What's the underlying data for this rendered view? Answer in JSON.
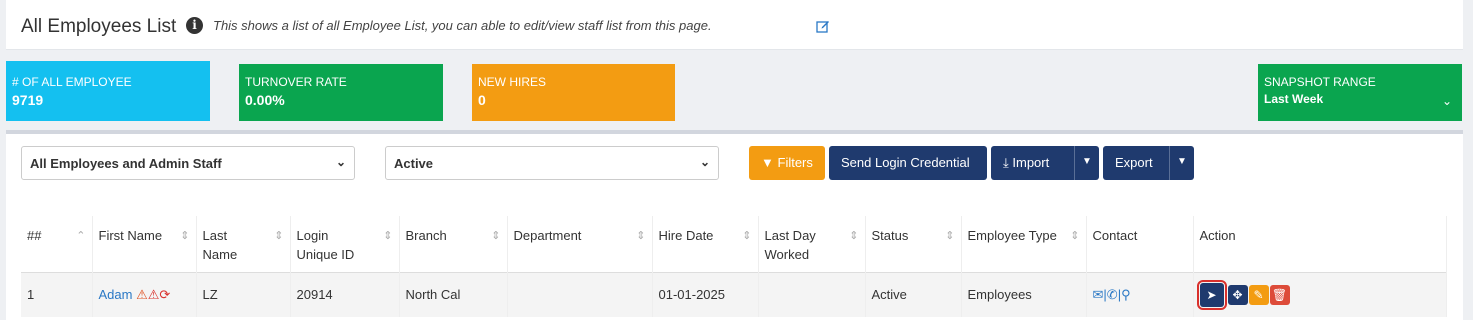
{
  "header": {
    "title": "All Employees List",
    "description": "This shows a list of all Employee List, you can able to edit/view staff list from this page.",
    "info_icon": "info-icon",
    "edit_icon": "edit-icon"
  },
  "stats": {
    "all_employee": {
      "label": "# OF ALL EMPLOYEE",
      "value": "9719",
      "color": "#14c0f0"
    },
    "turnover": {
      "label": "TURNOVER RATE",
      "value": "0.00%",
      "color": "#0aa54f"
    },
    "new_hires": {
      "label": "NEW HIRES",
      "value": "0",
      "color": "#f39c12"
    },
    "snapshot": {
      "label": "SNAPSHOT RANGE",
      "value": "Last Week",
      "color": "#0aa54f"
    }
  },
  "filters": {
    "staff_select": "All Employees and Admin Staff",
    "status_select": "Active",
    "filters_btn": "Filters",
    "send_btn": "Send Login Credential",
    "import_btn": "Import",
    "export_btn": "Export"
  },
  "table": {
    "headers": {
      "num": "##",
      "first": "First Name",
      "last_1": "Last",
      "last_2": "Name",
      "login_1": "Login",
      "login_2": "Unique ID",
      "branch": "Branch",
      "dept": "Department",
      "hire": "Hire Date",
      "lastday_1": "Last Day",
      "lastday_2": "Worked",
      "status": "Status",
      "emptype": "Employee Type",
      "contact": "Contact",
      "action": "Action"
    },
    "rows": [
      {
        "num": "1",
        "first": "Adam",
        "last": "LZ",
        "login": "20914",
        "branch": "North Cal",
        "dept": "",
        "hire": "01-01-2025",
        "lastday": "",
        "status": "Active",
        "emptype": "Employees"
      }
    ]
  }
}
